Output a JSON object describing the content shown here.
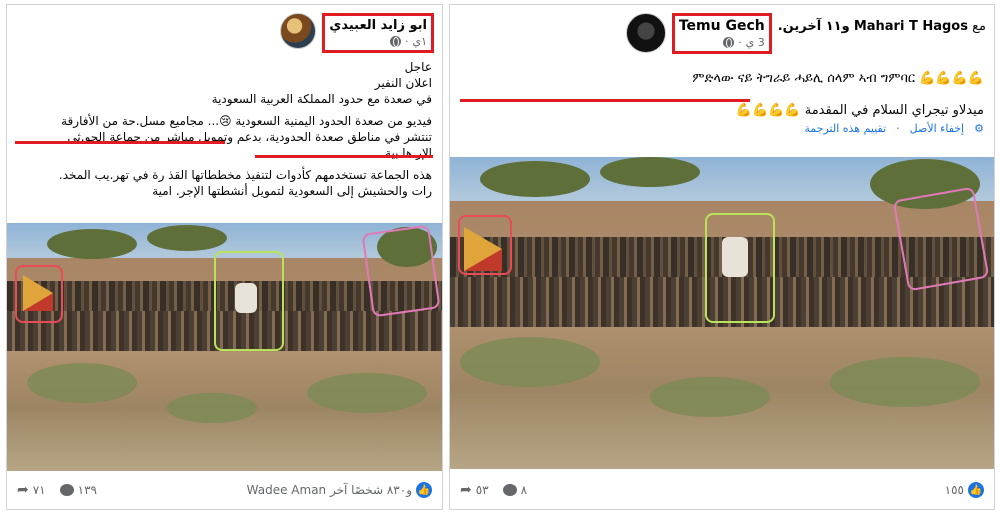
{
  "left_post": {
    "author": "ابو زايد العبيدي",
    "time": "١ي",
    "lines": [
      "عاجل",
      "اعلان النفير",
      "في صعدة مع حدود المملكة العربية السعودية",
      "فيديو من صعدة الحدود اليمنية السعودية 😢... مجاميع مسل.حة من الأفارقة",
      "تنتشر في مناطق صعدة الحدودية، بدعم وتمويل مباشر من جماعة الحو.ثي",
      "الإر.ها بية.",
      "هذه الجماعة تستخدمهم كأدوات لتنفيذ مخططاتها القذ رة في تهر.يب المخد.",
      "رات والحشيش إلى السعودية لتمويل أنشطتها الإجر. امية"
    ],
    "reactions_text": "Wadee Aman و٨٣٠ شخصًا آخر",
    "comments": "١٣٩",
    "shares": "٧١"
  },
  "right_post": {
    "author": "Temu Gech",
    "with_word": "مع",
    "with_person": "Mahari T Hagos",
    "with_others": "و١١ آخرين.",
    "time": "3 ي",
    "tigrinya": "ምድላው ናይ ትግራይ ሓይሊ ሰላም ኣብ ግምባር",
    "emojis": "💪💪💪💪",
    "arabic": "ميدلاو تيجراي السلام في المقدمة",
    "hide_original": "إخفاء الأصل",
    "rate_translation": "تقييم هذه الترجمة",
    "separator": "·",
    "likes": "١٥٥",
    "comments": "٨",
    "shares": "٥٣"
  }
}
